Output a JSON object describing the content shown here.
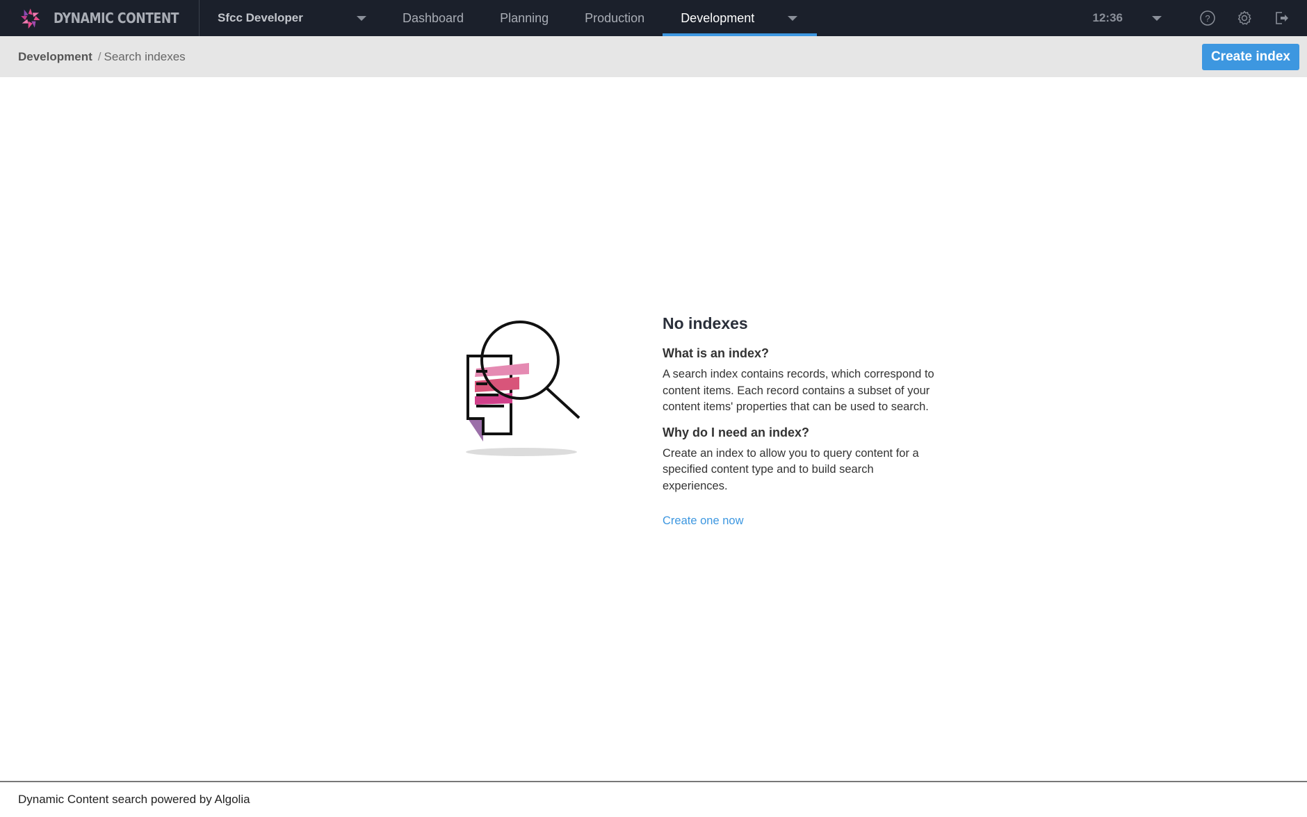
{
  "app": {
    "brand_name": "DYNAMIC CONTENT",
    "hub_name": "Sfcc Developer",
    "accent_color": "#3d97e0"
  },
  "nav": {
    "tabs": [
      {
        "label": "Dashboard",
        "active": false
      },
      {
        "label": "Planning",
        "active": false
      },
      {
        "label": "Production",
        "active": false
      },
      {
        "label": "Development",
        "active": true
      }
    ],
    "clock": "12:36",
    "icons": [
      "help-icon",
      "settings-icon",
      "logout-icon"
    ]
  },
  "breadcrumb": {
    "root": "Development",
    "separator": "/",
    "current": "Search indexes"
  },
  "toolbar": {
    "create_label": "Create index"
  },
  "empty_state": {
    "title": "No indexes",
    "q1": "What is an index?",
    "a1": "A search index contains records, which correspond to content items. Each record contains a subset of your content items' properties that can be used to search.",
    "q2": "Why do I need an index?",
    "a2": "Create an index to allow you to query content for a specified content type and to build search experiences.",
    "link": "Create one now"
  },
  "footer": {
    "text": "Dynamic Content search powered by Algolia"
  }
}
